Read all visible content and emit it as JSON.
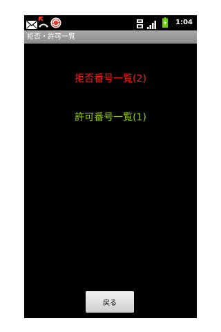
{
  "status_bar": {
    "time": "1:04",
    "icons": [
      "mail-icon",
      "missed-call-icon",
      "sync-icon",
      "network-type-icon",
      "signal-icon",
      "battery-charging-icon"
    ]
  },
  "title_bar": {
    "title": "拒否・許可一覧"
  },
  "lists": {
    "reject_label": "拒否番号一覧(2)",
    "reject_color": "#ff1a1a",
    "allow_label": "許可番号一覧(1)",
    "allow_color": "#99cc00"
  },
  "footer": {
    "back_label": "戻る"
  }
}
